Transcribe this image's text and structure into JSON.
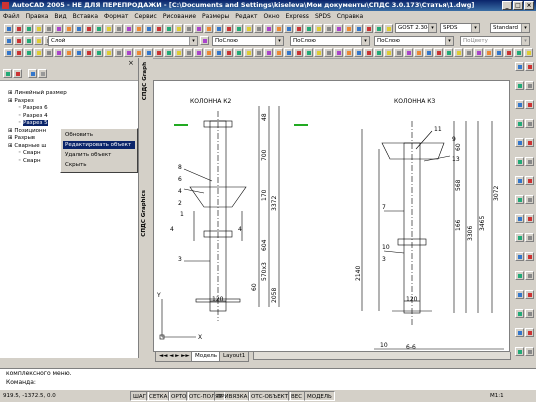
{
  "window": {
    "title": "AutoCAD 2005 - НЕ ДЛЯ ПЕРЕПРОДАЖИ - [C:\\Documents and Settings\\kiseleva\\Мои документы\\СПДС 3.0.173\\Статья\\1.dwg]"
  },
  "menu": [
    "Файл",
    "Правка",
    "Вид",
    "Вставка",
    "Формат",
    "Сервис",
    "Рисование",
    "Размеры",
    "Редакт",
    "Окно",
    "Express",
    "SPDS",
    "Справка"
  ],
  "toolbar": {
    "textstyle": "GOST 2.304",
    "dimstyle": "SPDS",
    "tablestyle": "Standard",
    "layer": "Слой",
    "color": "ПоСлою",
    "linetype": "ПоСлою",
    "lineweight": "ПоСлою",
    "plotstyle": "ПоЦвету"
  },
  "tree": {
    "items": [
      {
        "label": "Линейный размер",
        "level": 0
      },
      {
        "label": "Разрез",
        "level": 0
      },
      {
        "label": "Разрез 6",
        "level": 1
      },
      {
        "label": "Разрез 4",
        "level": 1
      },
      {
        "label": "Разрез 5",
        "level": 1
      },
      {
        "label": "Позиционн",
        "level": 0
      },
      {
        "label": "Разрыв",
        "level": 0
      },
      {
        "label": "Сварные ш",
        "level": 0
      },
      {
        "label": "Сварн",
        "level": 1
      },
      {
        "label": "Сварн",
        "level": 1
      }
    ]
  },
  "side_tabs": {
    "left_tab": "СПДС Graphics",
    "right_tab": "СПДС Graph"
  },
  "context_menu": {
    "items": [
      "Обновить",
      "Редактировать объект",
      "Удалить объект",
      "Скрыть"
    ],
    "highlighted": "Редактировать объект"
  },
  "drawing": {
    "title_k2": "КОЛОННА К2",
    "title_k3": "КОЛОННА К3",
    "dims_k2": [
      "48",
      "700",
      "3372",
      "170",
      "604",
      "570x3",
      "60",
      "2058"
    ],
    "dims_k3": [
      "60",
      "568",
      "166",
      "3306",
      "3465",
      "3072",
      "2140"
    ],
    "labels_k2": [
      "8",
      "6",
      "4",
      "2",
      "3",
      "1",
      "4",
      "4"
    ],
    "labels_k3": [
      "11",
      "9",
      "13",
      "7",
      "10",
      "3"
    ],
    "width_k2": "120",
    "width_k3": "120",
    "section_mark": "6-6",
    "section_num": "10",
    "axis_x": "X",
    "axis_y": "Y"
  },
  "tabs": {
    "model": "Модель",
    "layout": "Layout1"
  },
  "command": {
    "line1": "комплексного меню.",
    "line2": "Команда:"
  },
  "status": {
    "coords": "919.5, -1372.5, 0.0",
    "buttons": [
      "ШАГ",
      "СЕТКА",
      "ОРТО",
      "ОТС-ПОЛЯР",
      "ПРИВЯЗКА",
      "ОТС-ОБЪЕКТ",
      "ВЕС",
      "МОДЕЛЬ"
    ],
    "scale": "М1:1"
  }
}
